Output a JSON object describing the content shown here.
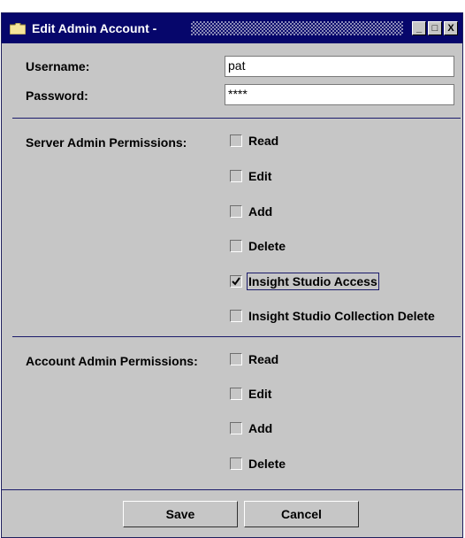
{
  "window": {
    "title": "Edit Admin Account -",
    "controls": {
      "minimize": "_",
      "maximize": "□",
      "close": "X"
    }
  },
  "form": {
    "username_label": "Username:",
    "username_value": "pat",
    "password_label": "Password:",
    "password_value": "****"
  },
  "server_permissions": {
    "label": "Server Admin Permissions:",
    "items": [
      {
        "label": "Read",
        "checked": false
      },
      {
        "label": "Edit",
        "checked": false
      },
      {
        "label": "Add",
        "checked": false
      },
      {
        "label": "Delete",
        "checked": false
      },
      {
        "label": "Insight Studio Access",
        "checked": true
      },
      {
        "label": "Insight Studio Collection Delete",
        "checked": false
      }
    ]
  },
  "account_permissions": {
    "label": "Account Admin Permissions:",
    "items": [
      {
        "label": "Read",
        "checked": false
      },
      {
        "label": "Edit",
        "checked": false
      },
      {
        "label": "Add",
        "checked": false
      },
      {
        "label": "Delete",
        "checked": false
      }
    ]
  },
  "buttons": {
    "save": "Save",
    "cancel": "Cancel"
  },
  "colors": {
    "titlebar": "#06066b",
    "background": "#c6c6c6",
    "separator": "#1b1b6b"
  }
}
